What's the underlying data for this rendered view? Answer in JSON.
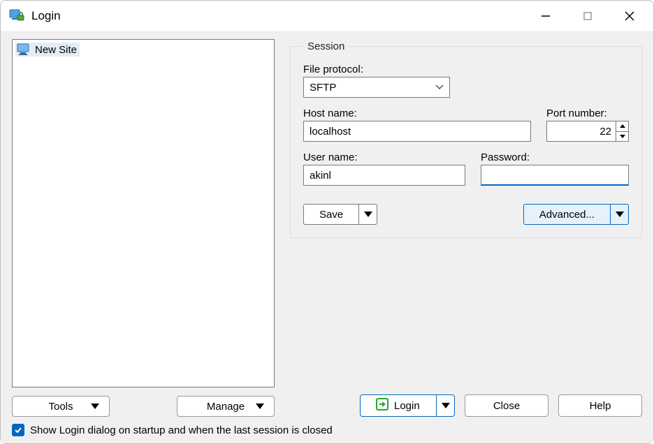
{
  "window": {
    "title": "Login"
  },
  "sites": {
    "items": [
      {
        "label": "New Site"
      }
    ]
  },
  "session": {
    "legend": "Session",
    "protocol_label": "File protocol:",
    "protocol_value": "SFTP",
    "host_label": "Host name:",
    "host_value": "localhost",
    "port_label": "Port number:",
    "port_value": "22",
    "user_label": "User name:",
    "user_value": "akinl",
    "pass_label": "Password:",
    "pass_value": "",
    "save_label": "Save",
    "advanced_label": "Advanced..."
  },
  "toolbar": {
    "tools_label": "Tools",
    "manage_label": "Manage"
  },
  "bottom": {
    "login_label": "Login",
    "close_label": "Close",
    "help_label": "Help"
  },
  "options": {
    "show_on_startup_label": "Show Login dialog on startup and when the last session is closed",
    "show_on_startup_checked": true
  }
}
